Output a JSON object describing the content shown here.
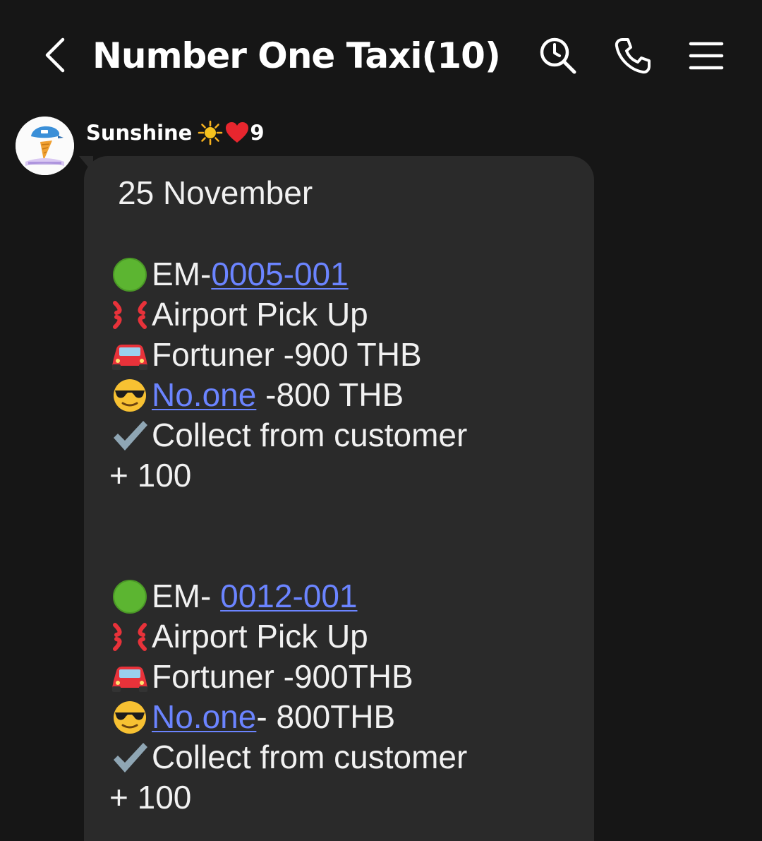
{
  "header": {
    "title": "Number One Taxi(10)"
  },
  "sender": {
    "name": "Sunshine",
    "suffix": "9"
  },
  "message": {
    "date": "25 November",
    "entries": [
      {
        "code_prefix": "EM-",
        "code_link": "0005-001",
        "service": "Airport Pick Up",
        "car": "Fortuner -900 THB",
        "driver_link": "No.one",
        "driver_rest": " -800 THB",
        "collect": "Collect from customer",
        "amount": "+ 100"
      },
      {
        "code_prefix": "EM- ",
        "code_link": "0012-001",
        "service": "Airport Pick Up",
        "car": "Fortuner -900THB",
        "driver_link": "No.one",
        "driver_rest": "- 800THB",
        "collect": "Collect from customer",
        "amount": "+ 100"
      }
    ]
  },
  "colors": {
    "background": "#161616",
    "bubble": "#2a2a2a",
    "link": "#6b84ff",
    "text": "#f1f1f1"
  },
  "icons": {
    "entry_marker": "green-circle-icon",
    "service": "anger-symbol-icon",
    "car": "car-icon",
    "driver": "sunglasses-face-icon",
    "collect": "check-mark-icon"
  }
}
